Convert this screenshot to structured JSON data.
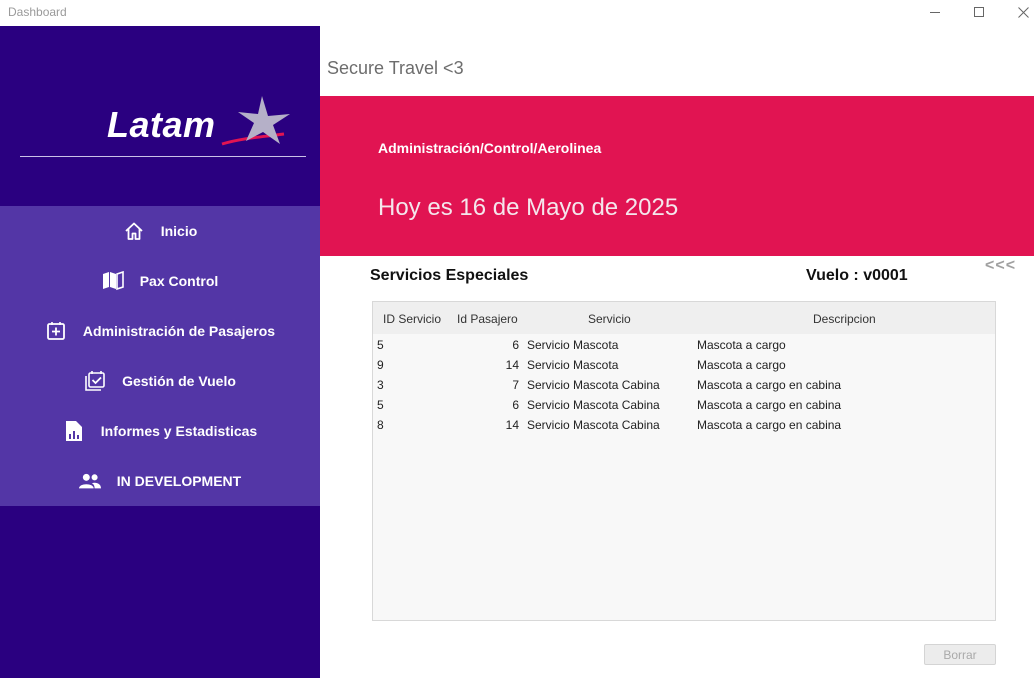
{
  "window": {
    "title": "Dashboard"
  },
  "brand": {
    "name": "Latam",
    "primary_color": "#2a0080",
    "menu_color": "#5336a6",
    "accent_color": "#e11452"
  },
  "sidebar": {
    "items": [
      {
        "label": "Inicio",
        "icon": "home-icon"
      },
      {
        "label": "Pax Control",
        "icon": "book-map-icon"
      },
      {
        "label": "Administración de Pasajeros",
        "icon": "add-box-icon"
      },
      {
        "label": "Gestión de Vuelo",
        "icon": "calendar-check-icon"
      },
      {
        "label": "Informes y Estadisticas",
        "icon": "report-chart-icon"
      },
      {
        "label": "IN DEVELOPMENT",
        "icon": "people-icon"
      }
    ]
  },
  "header": {
    "app_title": "Secure Travel <3",
    "breadcrumb": "Administración/Control/Aerolinea",
    "date_text": "Hoy es 16 de Mayo de 2025"
  },
  "main": {
    "section_title": "Servicios Especiales",
    "flight_label": "Vuelo : v0001",
    "back_label": "<<<",
    "table": {
      "columns": [
        "ID Servicio",
        "Id Pasajero",
        "Servicio",
        "Descripcion"
      ],
      "rows": [
        [
          "5",
          "6",
          "Servicio Mascota",
          "Mascota a cargo"
        ],
        [
          "9",
          "14",
          "Servicio Mascota",
          "Mascota a cargo"
        ],
        [
          "3",
          "7",
          "Servicio Mascota Cabina",
          "Mascota a cargo en cabina"
        ],
        [
          "5",
          "6",
          "Servicio Mascota Cabina",
          "Mascota a cargo en cabina"
        ],
        [
          "8",
          "14",
          "Servicio Mascota Cabina",
          "Mascota a cargo en cabina"
        ]
      ]
    },
    "delete_button": "Borrar"
  }
}
